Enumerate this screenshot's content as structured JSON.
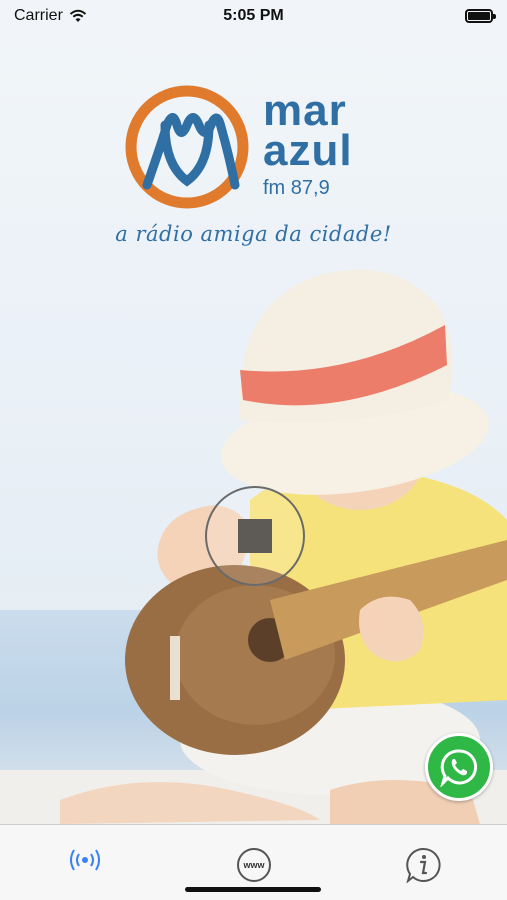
{
  "status_bar": {
    "carrier": "Carrier",
    "time": "5:05 PM",
    "battery_level": 1.0
  },
  "logo": {
    "brand_line1": "mar",
    "brand_line2": "azul",
    "frequency": "fm 87,9",
    "tagline": "a rádio amiga da cidade!",
    "colors": {
      "orange": "#e07a2c",
      "blue": "#2f6fa4"
    }
  },
  "player": {
    "control": "stop",
    "control_icon": "stop-icon"
  },
  "whatsapp": {
    "icon": "whatsapp-icon",
    "color": "#2fb845"
  },
  "tabs": [
    {
      "icon": "radio-broadcast-icon",
      "selected": true
    },
    {
      "icon": "www-icon",
      "label": "www",
      "selected": false
    },
    {
      "icon": "info-icon",
      "selected": false
    }
  ],
  "colors": {
    "tab_selected": "#3a80f6",
    "tab_unselected": "#8e8e93"
  }
}
